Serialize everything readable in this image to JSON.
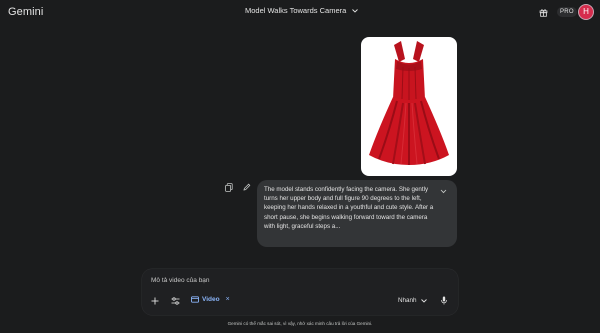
{
  "header": {
    "brand": "Gemini",
    "conversation_title": "Model Walks Towards Camera",
    "title_dropdown_icon": "chevron-down-icon",
    "gift_icon": "gift-icon",
    "pro_badge": "PRO",
    "avatar_letter": "H",
    "avatar_color": "#d62d4d"
  },
  "message": {
    "image_description_icon": "red-dress-image",
    "copy_icon": "copy-icon",
    "edit_icon": "edit-icon",
    "prompt_text": "The model stands confidently facing the camera. She gently turns her upper body and full figure 90 degrees to the left, keeping her hands relaxed in a youthful and cute style. After a short pause, she begins walking forward toward the camera with light, graceful steps a...",
    "expand_icon": "chevron-down-icon"
  },
  "composer": {
    "placeholder": "Mô tả video của bạn",
    "plus_icon": "plus-icon",
    "tools_icon": "tools-icon",
    "video_chip_label": "Video",
    "video_chip_close": "×",
    "mode_label": "Nhanh",
    "mic_icon": "mic-icon",
    "accent_color": "#8ab4f8"
  },
  "footer": {
    "disclaimer": "Gemini có thể mắc sai sót, vì vậy, nhớ xác minh câu trả lời của Gemini."
  }
}
